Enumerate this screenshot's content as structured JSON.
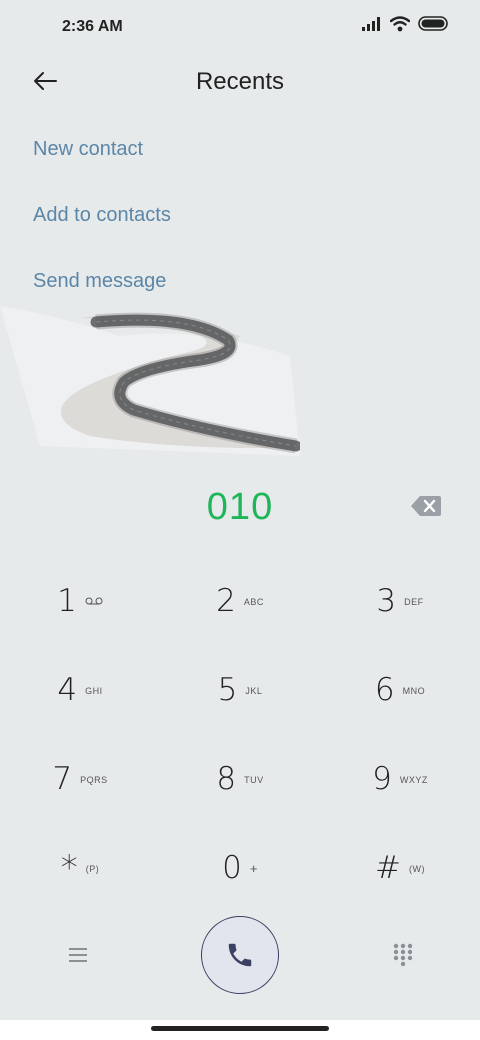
{
  "status_bar": {
    "time": "2:36 AM"
  },
  "header": {
    "title": "Recents"
  },
  "actions": {
    "new_contact": "New contact",
    "add_to_contacts": "Add to contacts",
    "send_message": "Send message"
  },
  "dialer": {
    "number": "010"
  },
  "keypad": {
    "k1": {
      "digit": "1",
      "letters": ""
    },
    "k2": {
      "digit": "2",
      "letters": "ABC"
    },
    "k3": {
      "digit": "3",
      "letters": "DEF"
    },
    "k4": {
      "digit": "4",
      "letters": "GHI"
    },
    "k5": {
      "digit": "5",
      "letters": "JKL"
    },
    "k6": {
      "digit": "6",
      "letters": "MNO"
    },
    "k7": {
      "digit": "7",
      "letters": "PQRS"
    },
    "k8": {
      "digit": "8",
      "letters": "TUV"
    },
    "k9": {
      "digit": "9",
      "letters": "WXYZ"
    },
    "kstar": {
      "digit": "*",
      "letters": "(P)"
    },
    "k0": {
      "digit": "0",
      "letters": "+"
    },
    "khash": {
      "digit": "#",
      "letters": "(W)"
    }
  },
  "colors": {
    "accent_link": "#5b86a7",
    "number": "#1fb65a",
    "call_icon": "#3c4062"
  },
  "icons": {
    "back": "arrow-left-icon",
    "signal": "signal-icon",
    "wifi": "wifi-icon",
    "battery": "battery-icon",
    "backspace": "backspace-icon",
    "voicemail": "voicemail-icon",
    "menu": "menu-icon",
    "call": "phone-icon",
    "dialpad": "dialpad-icon"
  }
}
